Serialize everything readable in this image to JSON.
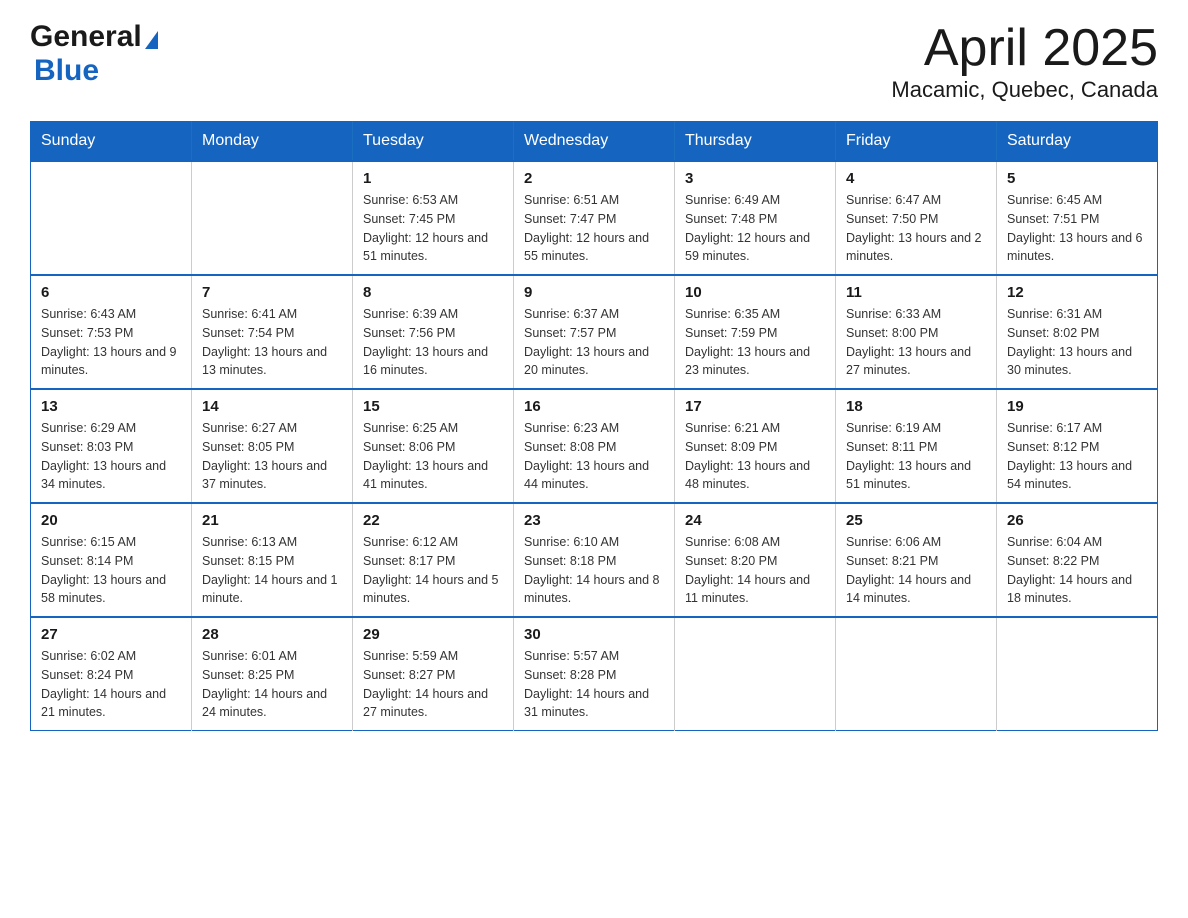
{
  "header": {
    "logo": {
      "general": "General",
      "triangle": "▶",
      "blue": "Blue"
    },
    "title": "April 2025",
    "subtitle": "Macamic, Quebec, Canada"
  },
  "calendar": {
    "days_of_week": [
      "Sunday",
      "Monday",
      "Tuesday",
      "Wednesday",
      "Thursday",
      "Friday",
      "Saturday"
    ],
    "weeks": [
      [
        {
          "day": "",
          "sunrise": "",
          "sunset": "",
          "daylight": ""
        },
        {
          "day": "",
          "sunrise": "",
          "sunset": "",
          "daylight": ""
        },
        {
          "day": "1",
          "sunrise": "Sunrise: 6:53 AM",
          "sunset": "Sunset: 7:45 PM",
          "daylight": "Daylight: 12 hours and 51 minutes."
        },
        {
          "day": "2",
          "sunrise": "Sunrise: 6:51 AM",
          "sunset": "Sunset: 7:47 PM",
          "daylight": "Daylight: 12 hours and 55 minutes."
        },
        {
          "day": "3",
          "sunrise": "Sunrise: 6:49 AM",
          "sunset": "Sunset: 7:48 PM",
          "daylight": "Daylight: 12 hours and 59 minutes."
        },
        {
          "day": "4",
          "sunrise": "Sunrise: 6:47 AM",
          "sunset": "Sunset: 7:50 PM",
          "daylight": "Daylight: 13 hours and 2 minutes."
        },
        {
          "day": "5",
          "sunrise": "Sunrise: 6:45 AM",
          "sunset": "Sunset: 7:51 PM",
          "daylight": "Daylight: 13 hours and 6 minutes."
        }
      ],
      [
        {
          "day": "6",
          "sunrise": "Sunrise: 6:43 AM",
          "sunset": "Sunset: 7:53 PM",
          "daylight": "Daylight: 13 hours and 9 minutes."
        },
        {
          "day": "7",
          "sunrise": "Sunrise: 6:41 AM",
          "sunset": "Sunset: 7:54 PM",
          "daylight": "Daylight: 13 hours and 13 minutes."
        },
        {
          "day": "8",
          "sunrise": "Sunrise: 6:39 AM",
          "sunset": "Sunset: 7:56 PM",
          "daylight": "Daylight: 13 hours and 16 minutes."
        },
        {
          "day": "9",
          "sunrise": "Sunrise: 6:37 AM",
          "sunset": "Sunset: 7:57 PM",
          "daylight": "Daylight: 13 hours and 20 minutes."
        },
        {
          "day": "10",
          "sunrise": "Sunrise: 6:35 AM",
          "sunset": "Sunset: 7:59 PM",
          "daylight": "Daylight: 13 hours and 23 minutes."
        },
        {
          "day": "11",
          "sunrise": "Sunrise: 6:33 AM",
          "sunset": "Sunset: 8:00 PM",
          "daylight": "Daylight: 13 hours and 27 minutes."
        },
        {
          "day": "12",
          "sunrise": "Sunrise: 6:31 AM",
          "sunset": "Sunset: 8:02 PM",
          "daylight": "Daylight: 13 hours and 30 minutes."
        }
      ],
      [
        {
          "day": "13",
          "sunrise": "Sunrise: 6:29 AM",
          "sunset": "Sunset: 8:03 PM",
          "daylight": "Daylight: 13 hours and 34 minutes."
        },
        {
          "day": "14",
          "sunrise": "Sunrise: 6:27 AM",
          "sunset": "Sunset: 8:05 PM",
          "daylight": "Daylight: 13 hours and 37 minutes."
        },
        {
          "day": "15",
          "sunrise": "Sunrise: 6:25 AM",
          "sunset": "Sunset: 8:06 PM",
          "daylight": "Daylight: 13 hours and 41 minutes."
        },
        {
          "day": "16",
          "sunrise": "Sunrise: 6:23 AM",
          "sunset": "Sunset: 8:08 PM",
          "daylight": "Daylight: 13 hours and 44 minutes."
        },
        {
          "day": "17",
          "sunrise": "Sunrise: 6:21 AM",
          "sunset": "Sunset: 8:09 PM",
          "daylight": "Daylight: 13 hours and 48 minutes."
        },
        {
          "day": "18",
          "sunrise": "Sunrise: 6:19 AM",
          "sunset": "Sunset: 8:11 PM",
          "daylight": "Daylight: 13 hours and 51 minutes."
        },
        {
          "day": "19",
          "sunrise": "Sunrise: 6:17 AM",
          "sunset": "Sunset: 8:12 PM",
          "daylight": "Daylight: 13 hours and 54 minutes."
        }
      ],
      [
        {
          "day": "20",
          "sunrise": "Sunrise: 6:15 AM",
          "sunset": "Sunset: 8:14 PM",
          "daylight": "Daylight: 13 hours and 58 minutes."
        },
        {
          "day": "21",
          "sunrise": "Sunrise: 6:13 AM",
          "sunset": "Sunset: 8:15 PM",
          "daylight": "Daylight: 14 hours and 1 minute."
        },
        {
          "day": "22",
          "sunrise": "Sunrise: 6:12 AM",
          "sunset": "Sunset: 8:17 PM",
          "daylight": "Daylight: 14 hours and 5 minutes."
        },
        {
          "day": "23",
          "sunrise": "Sunrise: 6:10 AM",
          "sunset": "Sunset: 8:18 PM",
          "daylight": "Daylight: 14 hours and 8 minutes."
        },
        {
          "day": "24",
          "sunrise": "Sunrise: 6:08 AM",
          "sunset": "Sunset: 8:20 PM",
          "daylight": "Daylight: 14 hours and 11 minutes."
        },
        {
          "day": "25",
          "sunrise": "Sunrise: 6:06 AM",
          "sunset": "Sunset: 8:21 PM",
          "daylight": "Daylight: 14 hours and 14 minutes."
        },
        {
          "day": "26",
          "sunrise": "Sunrise: 6:04 AM",
          "sunset": "Sunset: 8:22 PM",
          "daylight": "Daylight: 14 hours and 18 minutes."
        }
      ],
      [
        {
          "day": "27",
          "sunrise": "Sunrise: 6:02 AM",
          "sunset": "Sunset: 8:24 PM",
          "daylight": "Daylight: 14 hours and 21 minutes."
        },
        {
          "day": "28",
          "sunrise": "Sunrise: 6:01 AM",
          "sunset": "Sunset: 8:25 PM",
          "daylight": "Daylight: 14 hours and 24 minutes."
        },
        {
          "day": "29",
          "sunrise": "Sunrise: 5:59 AM",
          "sunset": "Sunset: 8:27 PM",
          "daylight": "Daylight: 14 hours and 27 minutes."
        },
        {
          "day": "30",
          "sunrise": "Sunrise: 5:57 AM",
          "sunset": "Sunset: 8:28 PM",
          "daylight": "Daylight: 14 hours and 31 minutes."
        },
        {
          "day": "",
          "sunrise": "",
          "sunset": "",
          "daylight": ""
        },
        {
          "day": "",
          "sunrise": "",
          "sunset": "",
          "daylight": ""
        },
        {
          "day": "",
          "sunrise": "",
          "sunset": "",
          "daylight": ""
        }
      ]
    ]
  }
}
